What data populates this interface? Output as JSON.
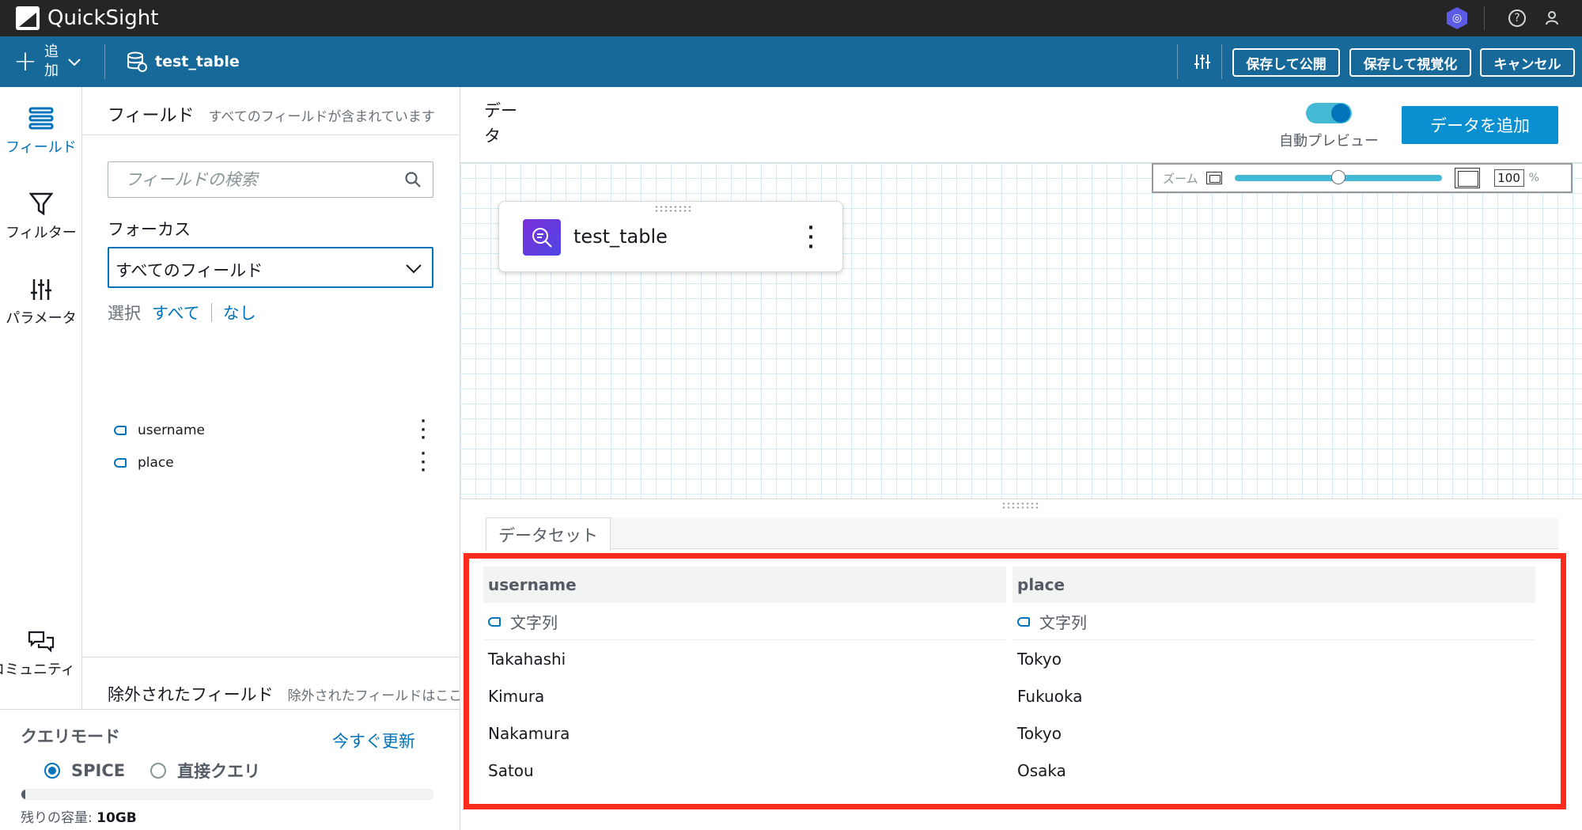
{
  "app": {
    "name": "QuickSight"
  },
  "toolbar": {
    "add_label": "追加",
    "dataset_name": "test_table",
    "save_publish_label": "保存して公開",
    "save_visualize_label": "保存して視覚化",
    "cancel_label": "キャンセル"
  },
  "rail": {
    "fields_label": "フィールド",
    "filter_label": "フィルター",
    "parameters_label": "パラメータ",
    "community_label": "コミュニティ"
  },
  "fields_panel": {
    "title": "フィールド",
    "subtitle": "すべてのフィールドが含まれています",
    "search_placeholder": "フィールドの検索",
    "focus_label": "フォーカス",
    "focus_value": "すべてのフィールド",
    "select_label": "選択",
    "select_all": "すべて",
    "select_none": "なし",
    "fields": [
      {
        "name": "username"
      },
      {
        "name": "place"
      }
    ],
    "excluded_title": "除外されたフィールド",
    "excluded_subtitle": "除外されたフィールドはここに表示されます"
  },
  "query_mode": {
    "title": "クエリモード",
    "refresh_label": "今すぐ更新",
    "spice_label": "SPICE",
    "direct_label": "直接クエリ",
    "selected": "SPICE",
    "capacity_used_fraction": 0.005,
    "capacity_label": "残りの容量:",
    "capacity_value": "10GB"
  },
  "main": {
    "title": "データ",
    "auto_preview_label": "自動プレビュー",
    "auto_preview_on": true,
    "add_data_label": "データを追加",
    "zoom_label": "ズーム",
    "zoom_value": "100",
    "zoom_unit": "%",
    "zoom_slider_fraction": 0.5,
    "table_node_name": "test_table",
    "preview_tab_label": "データセット"
  },
  "preview": {
    "columns": [
      {
        "name": "username",
        "type": "文字列"
      },
      {
        "name": "place",
        "type": "文字列"
      }
    ],
    "rows": [
      [
        "Takahashi",
        "Tokyo"
      ],
      [
        "Kimura",
        "Fukuoka"
      ],
      [
        "Nakamura",
        "Tokyo"
      ],
      [
        "Satou",
        "Osaka"
      ]
    ]
  },
  "colors": {
    "accent": "#0073bb",
    "toolbar_bg": "#17699a",
    "highlight_border": "#ff2b1c"
  }
}
